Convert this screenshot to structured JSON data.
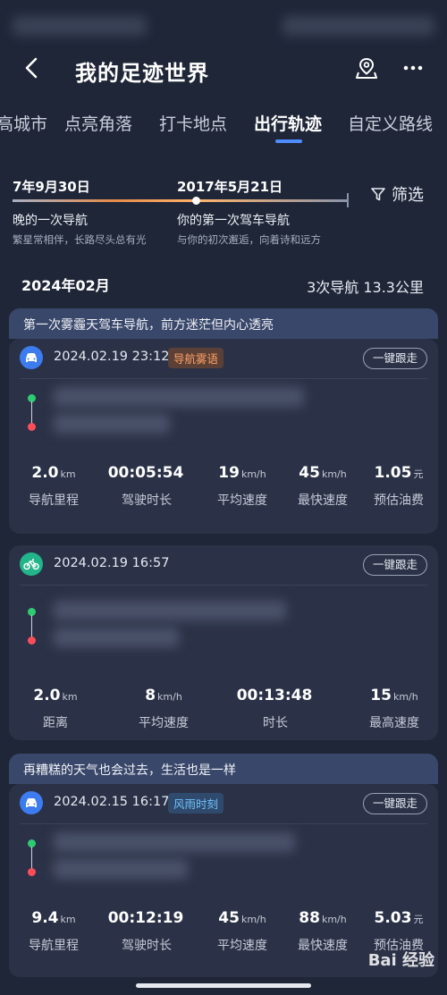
{
  "header": {
    "title": "我的足迹世界"
  },
  "tabs": [
    {
      "label": "高城市"
    },
    {
      "label": "点亮角落"
    },
    {
      "label": "打卡地点"
    },
    {
      "label": "出行轨迹"
    },
    {
      "label": "自定义路线"
    }
  ],
  "timeline": {
    "left_date": "7年9月30日",
    "left_heading": "晚的一次导航",
    "left_sub": "繁星常相伴，长路尽头总有光",
    "right_date": "2017年5月21日",
    "right_heading": "你的第一次驾车导航",
    "right_sub": "与你的初次邂逅，向着诗和远方",
    "filter_label": "筛选"
  },
  "month": {
    "label": "2024年02月",
    "summary": "3次导航 13.3公里"
  },
  "groups": [
    {
      "banner": "第一次雾霾天驾车导航，前方迷茫但内心透亮",
      "trip": {
        "mode_icon": "car-icon",
        "time": "2024.02.19 23:12",
        "tag": "导航雾语",
        "follow": "一键跟走",
        "stats": [
          {
            "value": "2.0",
            "unit": "km",
            "label": "导航里程"
          },
          {
            "value": "00:05:54",
            "unit": "",
            "label": "驾驶时长"
          },
          {
            "value": "19",
            "unit": "km/h",
            "label": "平均速度"
          },
          {
            "value": "45",
            "unit": "km/h",
            "label": "最快速度"
          },
          {
            "value": "1.05",
            "unit": "元",
            "label": "预估油费"
          }
        ]
      }
    },
    {
      "banner": "",
      "trip": {
        "mode_icon": "bike-icon",
        "time": "2024.02.19 16:57",
        "tag": "",
        "follow": "一键跟走",
        "stats": [
          {
            "value": "2.0",
            "unit": "km",
            "label": "距离"
          },
          {
            "value": "8",
            "unit": "km/h",
            "label": "平均速度"
          },
          {
            "value": "00:13:48",
            "unit": "",
            "label": "时长"
          },
          {
            "value": "15",
            "unit": "km/h",
            "label": "最高速度"
          }
        ]
      }
    },
    {
      "banner": "再糟糕的天气也会过去，生活也是一样",
      "trip": {
        "mode_icon": "car-icon",
        "time": "2024.02.15 16:17",
        "tag": "风雨时刻",
        "follow": "一键跟走",
        "stats": [
          {
            "value": "9.4",
            "unit": "km",
            "label": "导航里程"
          },
          {
            "value": "00:12:19",
            "unit": "",
            "label": "驾驶时长"
          },
          {
            "value": "45",
            "unit": "km/h",
            "label": "平均速度"
          },
          {
            "value": "88",
            "unit": "km/h",
            "label": "最快速度"
          },
          {
            "value": "5.03",
            "unit": "元",
            "label": "预估油费"
          }
        ]
      }
    }
  ],
  "watermark": "Bai 经验",
  "colors": {
    "accent": "#4d8dff",
    "car": "#3d7cf0",
    "bike": "#22b58a",
    "tag_orange": "#ffa067",
    "tag_blue": "#6fc3ff"
  }
}
